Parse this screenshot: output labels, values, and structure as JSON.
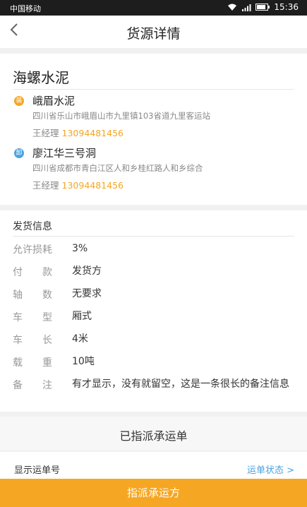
{
  "status_bar": {
    "carrier": "中国移动",
    "time": "15:36"
  },
  "header": {
    "back_icon": "chevron-left",
    "title": "货源详情"
  },
  "goods": {
    "name": "海螺水泥"
  },
  "stops": [
    {
      "type": "loading",
      "badge": "装",
      "badge_color": "#f5a623",
      "name": "峨眉水泥",
      "address": "四川省乐山市峨眉山市九里镇103省道九里客运站",
      "contact_label": "王经理",
      "phone": "13094481456"
    },
    {
      "type": "unloading",
      "badge": "卸",
      "badge_color": "#4aa3df",
      "name": "廖江华三号洞",
      "address": "四川省成都市青白江区人和乡桂红路人和乡综合",
      "contact_label": "王经理",
      "phone": "13094481456"
    }
  ],
  "shipping_info": {
    "title": "发货信息",
    "rows": [
      {
        "label": "允许损耗",
        "value": "3%"
      },
      {
        "label": "付　　款",
        "value": "发货方"
      },
      {
        "label": "轴　　数",
        "value": "无要求"
      },
      {
        "label": "车　　型",
        "value": "厢式"
      },
      {
        "label": "车　　长",
        "value": "4米"
      },
      {
        "label": "载　　重",
        "value": "10吨"
      },
      {
        "label": "备　　注",
        "value": "有才显示，没有就留空，这是一条很长的备注信息"
      }
    ]
  },
  "assigned": {
    "text": "已指派承运单"
  },
  "waybill_row": {
    "left": "显示运单号",
    "right": "运单状态 >"
  },
  "bottom_button": {
    "label": "指派承运方"
  },
  "colors": {
    "accent": "#f5a623",
    "blue": "#4aa3df"
  }
}
